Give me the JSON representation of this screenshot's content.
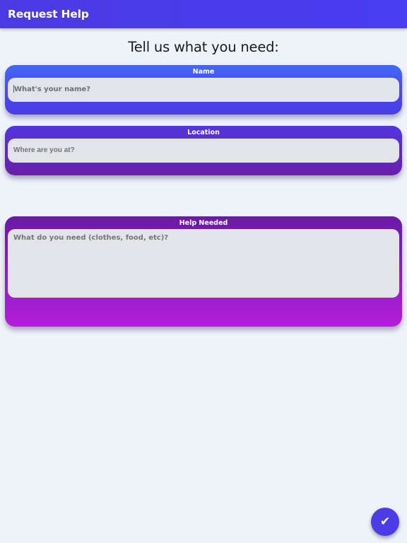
{
  "app_bar": {
    "title": "Request Help",
    "color": "#4b3ae4"
  },
  "heading": "Tell us what you need:",
  "form": {
    "name": {
      "label": "Name",
      "value": "",
      "placeholder": "What's your name?"
    },
    "location": {
      "label": "Location",
      "value": "",
      "placeholder": "Where are you at?"
    },
    "help": {
      "label": "Help Needed",
      "value": "",
      "placeholder": "What do you need (clothes, food, etc)?"
    }
  },
  "submit": {
    "icon": "check-icon",
    "glyph": "✔"
  }
}
